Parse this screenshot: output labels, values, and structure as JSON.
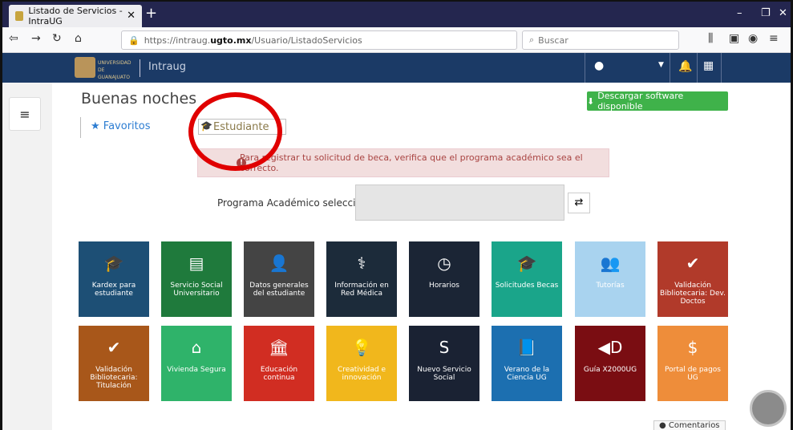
{
  "browser": {
    "tab_title": "Listado de Servicios - IntraUG",
    "url_prefix": "https://intraug.",
    "url_domain": "ugto.mx",
    "url_path": "/Usuario/ListadoServicios",
    "search_placeholder": "Buscar"
  },
  "site": {
    "logo_text": "UNIVERSIDAD DE GUANAJUATO",
    "name": "Intraug"
  },
  "page": {
    "greeting": "Buenas noches",
    "download_button": "Descargar software disponible",
    "tab_favorites": "Favoritos",
    "tab_student": "Estudiante",
    "alert": "Para registrar tu solicitud de beca, verifica que el programa académico sea el correcto.",
    "program_label": "Programa Académico seleccionado:",
    "program_value": "",
    "comments": "Comentarios"
  },
  "tiles": [
    {
      "label": "Kardex para estudiante",
      "color": "#1d4f75",
      "icon": "graduation-cap-icon",
      "glyph": "🎓"
    },
    {
      "label": "Servicio Social Universitario",
      "color": "#1f7a3c",
      "icon": "list-icon",
      "glyph": "▤"
    },
    {
      "label": "Datos generales del estudiante",
      "color": "#444444",
      "icon": "user-icon",
      "glyph": "👤"
    },
    {
      "label": "Información en Red Médica",
      "color": "#1c2b3a",
      "icon": "doctor-icon",
      "glyph": "⚕"
    },
    {
      "label": "Horarios",
      "color": "#1b2535",
      "icon": "clock-icon",
      "glyph": "◷"
    },
    {
      "label": "Solicitudes Becas",
      "color": "#1aa58a",
      "icon": "graduation-cap-icon",
      "glyph": "🎓"
    },
    {
      "label": "Tutorías",
      "color": "#a9d3ef",
      "icon": "group-icon",
      "glyph": "👥"
    },
    {
      "label": "Validación Bibliotecaria: Dev. Doctos",
      "color": "#b13a2a",
      "icon": "check-circle-icon",
      "glyph": "✔"
    },
    {
      "label": "Validación Bibliotecaria: Titulación",
      "color": "#a8571a",
      "icon": "check-circle-icon",
      "glyph": "✔"
    },
    {
      "label": "Vivienda Segura",
      "color": "#2fb36a",
      "icon": "home-icon",
      "glyph": "⌂"
    },
    {
      "label": "Educación continua",
      "color": "#d12d22",
      "icon": "institution-icon",
      "glyph": "🏛"
    },
    {
      "label": "Creatividad e innovación",
      "color": "#f1b71c",
      "icon": "lightbulb-icon",
      "glyph": "💡"
    },
    {
      "label": "Nuevo Servicio Social",
      "color": "#1a2233",
      "icon": "servicio-social-logo-icon",
      "glyph": "S"
    },
    {
      "label": "Verano de la Ciencia UG",
      "color": "#1c6fb0",
      "icon": "book-icon",
      "glyph": "📘"
    },
    {
      "label": "Guía X2000UG",
      "color": "#7a0d12",
      "icon": "guia-logo-icon",
      "glyph": "◀D"
    },
    {
      "label": "Portal de pagos UG",
      "color": "#ee8d3a",
      "icon": "dollar-icon",
      "glyph": "$"
    }
  ]
}
